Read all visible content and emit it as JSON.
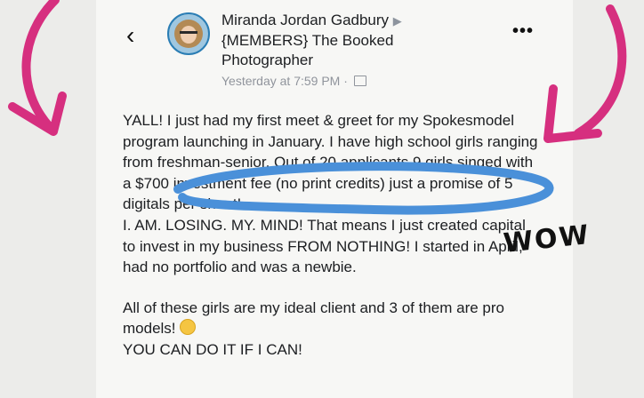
{
  "post": {
    "author": "Miranda Jordan Gadbury",
    "share_arrow": "▶",
    "group": "{MEMBERS} The Booked Photographer",
    "timestamp": "Yesterday at 7:59 PM · ",
    "audience_icon": "friends-icon"
  },
  "controls": {
    "back_icon": "‹",
    "more_icon": "•••"
  },
  "body": {
    "p1": "YALL! I just had my first meet & greet for my Spokesmodel program launching in January. I have high school girls ranging from freshman-senior. Out of 20 applicants 9 girls singed with a $700 investment fee (no print credits) just a promise of 5 digitals per shoot!",
    "p2": "I. AM. LOSING. MY. MIND! That means I just created capital to invest in my business FROM NOTHING!  I started in April, had no portfolio and was a newbie.",
    "p3": "All of these girls are my ideal client and 3 of them are pro models! ",
    "p3_emoji": "laughing-crying-emoji",
    "p4": " YOU CAN DO IT IF I CAN!"
  },
  "annotation": {
    "wow": "WOW",
    "ink_color": "#d62f7f",
    "circle_color": "#4a90d9"
  }
}
